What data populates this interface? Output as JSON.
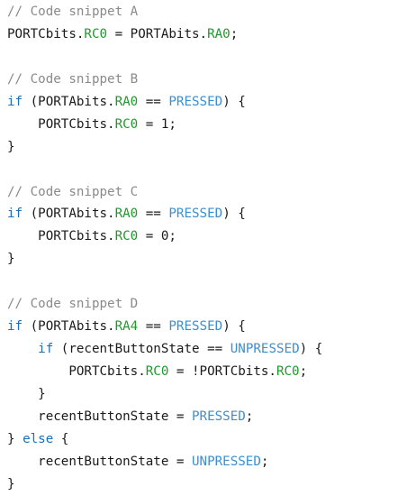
{
  "colors": {
    "comment": "#8a8a8a",
    "keyword": "#1c6fb8",
    "field": "#1f9a2a",
    "constant": "#3b8fd0",
    "text": "#1a1a1a",
    "background": "#ffffff"
  },
  "lines": [
    [
      [
        "comment",
        "// Code snippet A"
      ]
    ],
    [
      [
        "plain",
        "PORTCbits."
      ],
      [
        "field",
        "RC0"
      ],
      [
        "plain",
        " = PORTAbits."
      ],
      [
        "field",
        "RA0"
      ],
      [
        "plain",
        ";"
      ]
    ],
    [],
    [
      [
        "comment",
        "// Code snippet B"
      ]
    ],
    [
      [
        "keyword",
        "if"
      ],
      [
        "plain",
        " (PORTAbits."
      ],
      [
        "field",
        "RA0"
      ],
      [
        "plain",
        " == "
      ],
      [
        "constant",
        "PRESSED"
      ],
      [
        "plain",
        ") {"
      ]
    ],
    [
      [
        "plain",
        "    PORTCbits."
      ],
      [
        "field",
        "RC0"
      ],
      [
        "plain",
        " = 1;"
      ]
    ],
    [
      [
        "plain",
        "}"
      ]
    ],
    [],
    [
      [
        "comment",
        "// Code snippet C"
      ]
    ],
    [
      [
        "keyword",
        "if"
      ],
      [
        "plain",
        " (PORTAbits."
      ],
      [
        "field",
        "RA0"
      ],
      [
        "plain",
        " == "
      ],
      [
        "constant",
        "PRESSED"
      ],
      [
        "plain",
        ") {"
      ]
    ],
    [
      [
        "plain",
        "    PORTCbits."
      ],
      [
        "field",
        "RC0"
      ],
      [
        "plain",
        " = 0;"
      ]
    ],
    [
      [
        "plain",
        "}"
      ]
    ],
    [],
    [
      [
        "comment",
        "// Code snippet D"
      ]
    ],
    [
      [
        "keyword",
        "if"
      ],
      [
        "plain",
        " (PORTAbits."
      ],
      [
        "field",
        "RA4"
      ],
      [
        "plain",
        " == "
      ],
      [
        "constant",
        "PRESSED"
      ],
      [
        "plain",
        ") {"
      ]
    ],
    [
      [
        "plain",
        "    "
      ],
      [
        "keyword",
        "if"
      ],
      [
        "plain",
        " (recentButtonState == "
      ],
      [
        "constant",
        "UNPRESSED"
      ],
      [
        "plain",
        ") {"
      ]
    ],
    [
      [
        "plain",
        "        PORTCbits."
      ],
      [
        "field",
        "RC0"
      ],
      [
        "plain",
        " = !PORTCbits."
      ],
      [
        "field",
        "RC0"
      ],
      [
        "plain",
        ";"
      ]
    ],
    [
      [
        "plain",
        "    }"
      ]
    ],
    [
      [
        "plain",
        "    recentButtonState = "
      ],
      [
        "constant",
        "PRESSED"
      ],
      [
        "plain",
        ";"
      ]
    ],
    [
      [
        "plain",
        "} "
      ],
      [
        "keyword",
        "else"
      ],
      [
        "plain",
        " {"
      ]
    ],
    [
      [
        "plain",
        "    recentButtonState = "
      ],
      [
        "constant",
        "UNPRESSED"
      ],
      [
        "plain",
        ";"
      ]
    ],
    [
      [
        "plain",
        "}"
      ]
    ]
  ]
}
